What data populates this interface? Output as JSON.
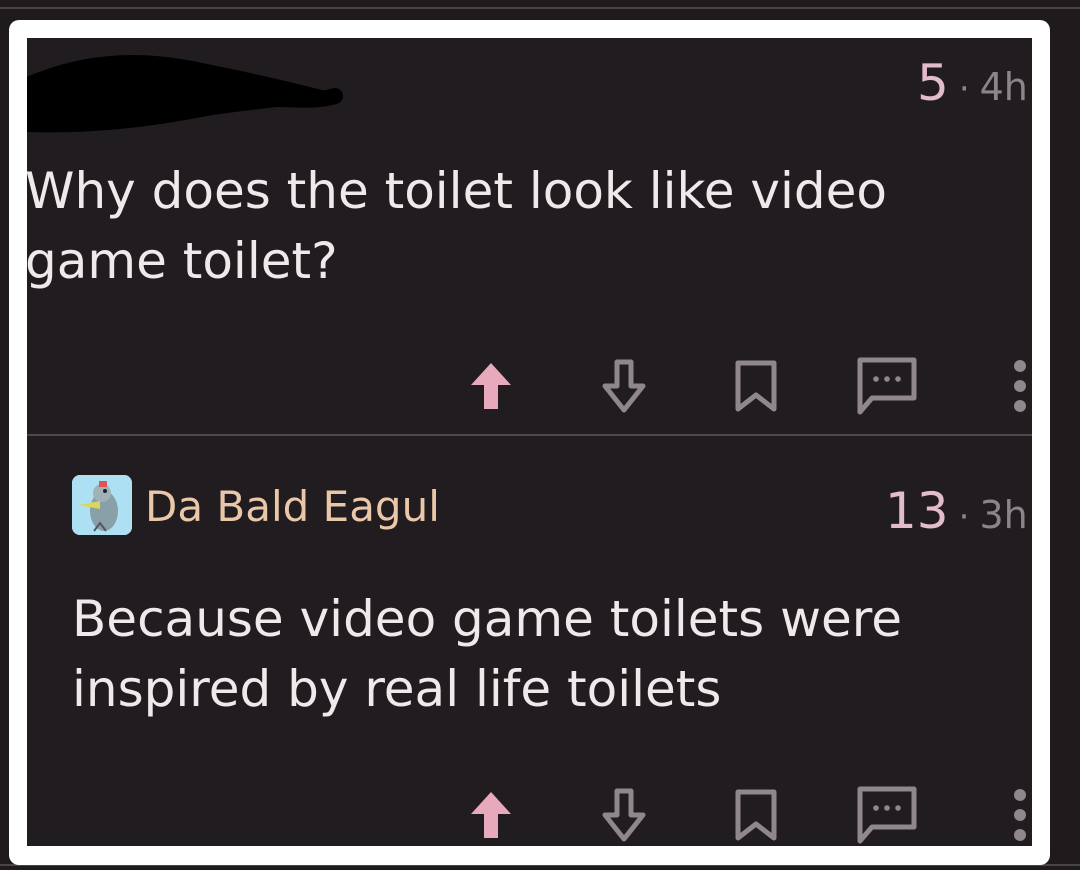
{
  "post": {
    "score": "5",
    "separator": "·",
    "age": "4h",
    "title": "Why does the toilet look like video game toilet?"
  },
  "comment": {
    "author": "Da Bald Eagul",
    "score": "13",
    "separator": "·",
    "age": "3h",
    "body": "Because video game toilets were inspired by real life toilets"
  },
  "icons": {
    "upvote": "arrow-up-icon",
    "downvote": "arrow-down-icon",
    "save": "bookmark-icon",
    "reply": "comment-icon",
    "more": "more-vertical-icon"
  },
  "colors": {
    "background": "#211c1f",
    "text": "#eeeaeb",
    "score": "#e3bccb",
    "author": "#eac7a8",
    "upvote_active": "#e8a9bd",
    "icon": "#8f878b",
    "frame": "#ffffff"
  }
}
